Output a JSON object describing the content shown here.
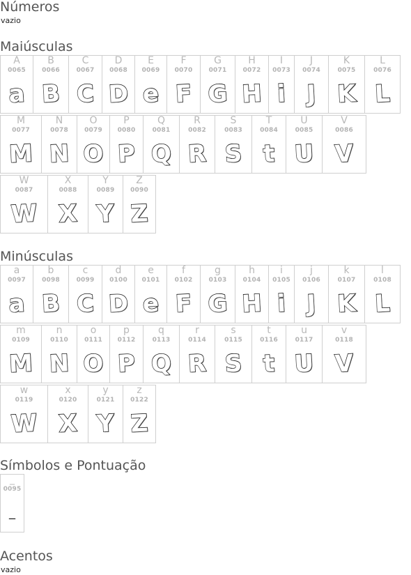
{
  "sections": {
    "numeros": {
      "title": "Números",
      "empty_text": "vazio"
    },
    "maiusculas": {
      "title": "Maiúsculas"
    },
    "minusculas": {
      "title": "Minúsculas"
    },
    "simbolos": {
      "title": "Símbolos e Pontuação"
    },
    "acentos": {
      "title": "Acentos",
      "empty_text": "vazio"
    }
  },
  "uppercase": [
    {
      "ch": "A",
      "code": "0065",
      "sample": "a"
    },
    {
      "ch": "B",
      "code": "0066",
      "sample": "B"
    },
    {
      "ch": "C",
      "code": "0067",
      "sample": "C"
    },
    {
      "ch": "D",
      "code": "0068",
      "sample": "D"
    },
    {
      "ch": "E",
      "code": "0069",
      "sample": "e"
    },
    {
      "ch": "F",
      "code": "0070",
      "sample": "F"
    },
    {
      "ch": "G",
      "code": "0071",
      "sample": "G"
    },
    {
      "ch": "H",
      "code": "0072",
      "sample": "H"
    },
    {
      "ch": "I",
      "code": "0073",
      "sample": "i"
    },
    {
      "ch": "J",
      "code": "0074",
      "sample": "J"
    },
    {
      "ch": "K",
      "code": "0075",
      "sample": "K"
    },
    {
      "ch": "L",
      "code": "0076",
      "sample": "L"
    },
    {
      "ch": "M",
      "code": "0077",
      "sample": "M"
    },
    {
      "ch": "N",
      "code": "0078",
      "sample": "N"
    },
    {
      "ch": "O",
      "code": "0079",
      "sample": "O"
    },
    {
      "ch": "P",
      "code": "0080",
      "sample": "P"
    },
    {
      "ch": "Q",
      "code": "0081",
      "sample": "Q"
    },
    {
      "ch": "R",
      "code": "0082",
      "sample": "R"
    },
    {
      "ch": "S",
      "code": "0083",
      "sample": "S"
    },
    {
      "ch": "T",
      "code": "0084",
      "sample": "t"
    },
    {
      "ch": "U",
      "code": "0085",
      "sample": "U"
    },
    {
      "ch": "V",
      "code": "0086",
      "sample": "V"
    },
    {
      "ch": "W",
      "code": "0087",
      "sample": "W"
    },
    {
      "ch": "X",
      "code": "0088",
      "sample": "X"
    },
    {
      "ch": "Y",
      "code": "0089",
      "sample": "Y"
    },
    {
      "ch": "Z",
      "code": "0090",
      "sample": "Z"
    }
  ],
  "lowercase": [
    {
      "ch": "a",
      "code": "0097",
      "sample": "a"
    },
    {
      "ch": "b",
      "code": "0098",
      "sample": "B"
    },
    {
      "ch": "c",
      "code": "0099",
      "sample": "C"
    },
    {
      "ch": "d",
      "code": "0100",
      "sample": "D"
    },
    {
      "ch": "e",
      "code": "0101",
      "sample": "e"
    },
    {
      "ch": "f",
      "code": "0102",
      "sample": "F"
    },
    {
      "ch": "g",
      "code": "0103",
      "sample": "G"
    },
    {
      "ch": "h",
      "code": "0104",
      "sample": "H"
    },
    {
      "ch": "i",
      "code": "0105",
      "sample": "i"
    },
    {
      "ch": "j",
      "code": "0106",
      "sample": "J"
    },
    {
      "ch": "k",
      "code": "0107",
      "sample": "K"
    },
    {
      "ch": "l",
      "code": "0108",
      "sample": "L"
    },
    {
      "ch": "m",
      "code": "0109",
      "sample": "M"
    },
    {
      "ch": "n",
      "code": "0110",
      "sample": "N"
    },
    {
      "ch": "o",
      "code": "0111",
      "sample": "O"
    },
    {
      "ch": "p",
      "code": "0112",
      "sample": "P"
    },
    {
      "ch": "q",
      "code": "0113",
      "sample": "Q"
    },
    {
      "ch": "r",
      "code": "0114",
      "sample": "R"
    },
    {
      "ch": "s",
      "code": "0115",
      "sample": "S"
    },
    {
      "ch": "t",
      "code": "0116",
      "sample": "t"
    },
    {
      "ch": "u",
      "code": "0117",
      "sample": "U"
    },
    {
      "ch": "v",
      "code": "0118",
      "sample": "V"
    },
    {
      "ch": "w",
      "code": "0119",
      "sample": "W"
    },
    {
      "ch": "x",
      "code": "0120",
      "sample": "X"
    },
    {
      "ch": "y",
      "code": "0121",
      "sample": "Y"
    },
    {
      "ch": "z",
      "code": "0122",
      "sample": "Z"
    }
  ],
  "symbols": [
    {
      "ch": "_",
      "code": "0095",
      "sample": "_"
    }
  ]
}
